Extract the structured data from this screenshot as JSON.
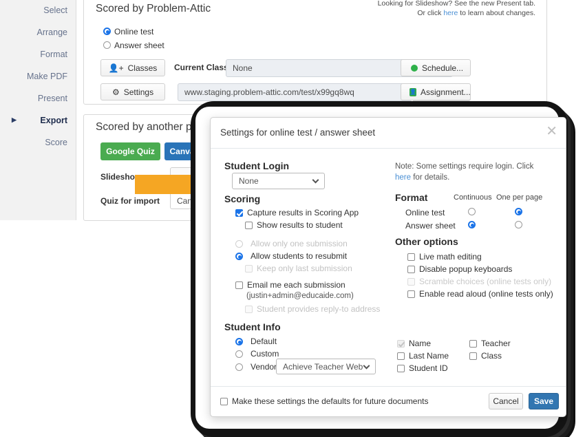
{
  "sidebar": {
    "items": [
      {
        "label": "Select",
        "active": false
      },
      {
        "label": "Arrange",
        "active": false
      },
      {
        "label": "Format",
        "active": false
      },
      {
        "label": "Make PDF",
        "active": false
      },
      {
        "label": "Present",
        "active": false
      },
      {
        "label": "Export",
        "active": true
      },
      {
        "label": "Score",
        "active": false
      }
    ],
    "active_marker": "▶"
  },
  "panel_top": {
    "title": "Scored by Problem-Attic",
    "note_line1_a": "Looking for Slideshow? See the new Present tab.",
    "note_line2_a": "Or click ",
    "note_link": "here",
    "note_line2_b": " to learn about changes.",
    "radio_online_test": "Online test",
    "radio_answer_sheet": "Answer sheet",
    "classes_button": "Classes",
    "classes_icon": "person-plus-icon",
    "settings_button": "Settings",
    "settings_icon": "gear-icon",
    "current_class_label": "Current Class:",
    "current_class_value": "None",
    "url_value": "www.staging.problem-attic.com/test/x99gq8wq",
    "icon_open": "external-link-icon",
    "icon_copy": "clipboard-copy-icon",
    "icon_qr": "qr-code-icon",
    "schedule_button": "Schedule...",
    "schedule_icon": "green-dot-icon",
    "assignment_button": "Assignment...",
    "assignment_icon": "google-classroom-icon"
  },
  "panel_bottom": {
    "title": "Scored by another program",
    "google_quiz_button": "Google Quiz",
    "google_quiz_color": "#4aab50",
    "canvas_quiz_button": "Canvas Quiz",
    "canvas_quiz_color": "#2a74b8",
    "slideshow_label": "Slideshow",
    "quiz_for_import_label": "Quiz for import",
    "quiz_for_import_value": "Canvas (QTI)",
    "arrow_color": "#f5a623",
    "arrow_name": "orange-pointer-arrow"
  },
  "modal": {
    "title": "Settings for online test / answer sheet",
    "close_icon": "close-icon",
    "note_prefix": "Note: Some settings require login. Click ",
    "note_link": "here",
    "note_suffix": " for details.",
    "student_login": {
      "heading": "Student Login",
      "value": "None"
    },
    "scoring": {
      "heading": "Scoring",
      "capture_results": "Capture results in Scoring App",
      "show_results": "Show results to student",
      "allow_one_submission": "Allow only one submission",
      "allow_resubmit": "Allow students to resubmit",
      "keep_last": "Keep only last submission",
      "email_each": "Email me each submission",
      "email_address": "(justin+admin@educaide.com)",
      "student_reply_to": "Student provides reply-to address"
    },
    "format": {
      "heading": "Format",
      "col_continuous": "Continuous",
      "col_one_per_page": "One per page",
      "row_online_test": "Online test",
      "row_answer_sheet": "Answer sheet"
    },
    "other_options": {
      "heading": "Other options",
      "live_math": "Live math editing",
      "disable_popup": "Disable popup keyboards",
      "scramble": "Scramble choices (online tests only)",
      "read_aloud": "Enable read aloud (online tests only)"
    },
    "student_info": {
      "heading": "Student Info",
      "default": "Default",
      "custom": "Custom",
      "vendor": "Vendor",
      "vendor_value": "Achieve Teacher Web",
      "name": "Name",
      "last_name": "Last Name",
      "student_id": "Student ID",
      "teacher": "Teacher",
      "class": "Class"
    },
    "footer": {
      "make_default": "Make these settings the defaults for future documents",
      "cancel": "Cancel",
      "save": "Save"
    }
  },
  "colors": {
    "accent_blue": "#1a73e8",
    "save_blue": "#3276b1",
    "green": "#4aab50",
    "orange": "#f5a623"
  }
}
